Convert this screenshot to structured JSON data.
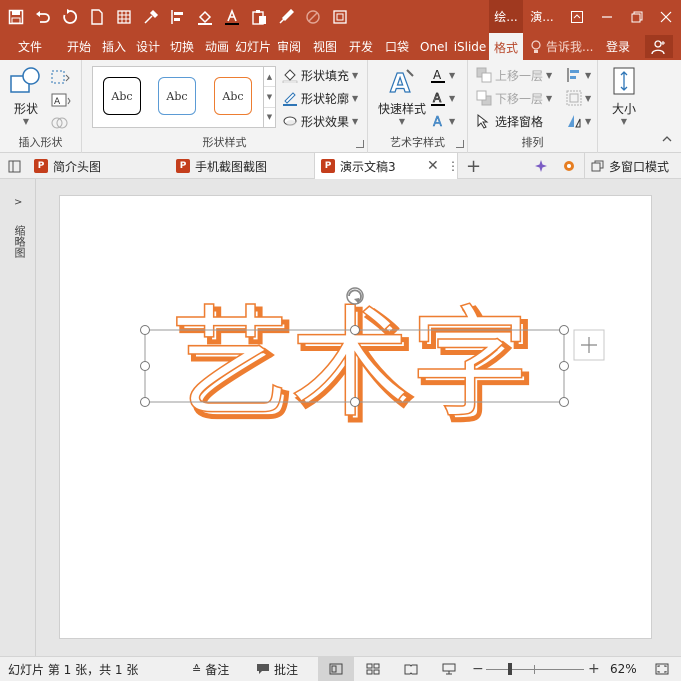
{
  "window": {
    "context_tab": "绘...",
    "title": "演...",
    "accent": "#b7472a"
  },
  "qat": [
    "save-icon",
    "undo-icon",
    "redo-icon",
    "new-icon",
    "grid-icon",
    "eyedropper-icon",
    "align-icon",
    "fill-icon",
    "font-color-icon",
    "paste-icon",
    "brush-icon",
    "disabled-icon",
    "crop-icon"
  ],
  "tabs": [
    "文件",
    "开始",
    "插入",
    "设计",
    "切换",
    "动画",
    "幻灯片",
    "审阅",
    "视图",
    "开发",
    "口袋",
    "OneI",
    "iSlide",
    "格式"
  ],
  "tellme": "告诉我...",
  "login": "登录",
  "ribbon": {
    "insert_shape": {
      "shape_label": "形状",
      "group_label": "插入形状"
    },
    "shape_styles": {
      "swatches": [
        "Abc",
        "Abc",
        "Abc"
      ],
      "swatch_colors": [
        "#000000",
        "#5b9bd5",
        "#ed7d31"
      ],
      "fill": "形状填充",
      "outline": "形状轮廓",
      "effects": "形状效果",
      "group_label": "形状样式"
    },
    "wordart": {
      "quick_styles": "快速样式",
      "group_label": "艺术字样式"
    },
    "arrange": {
      "bring_forward": "上移一层",
      "send_backward": "下移一层",
      "selection_pane": "选择窗格",
      "group_label": "排列"
    },
    "size": {
      "label": "大小"
    }
  },
  "doctabs": [
    {
      "name": "简介头图"
    },
    {
      "name": "手机截图截图"
    },
    {
      "name": "演示文稿3"
    }
  ],
  "doctabs_right": {
    "multi_window": "多窗口模式"
  },
  "slide": {
    "wordart_text": "艺术字",
    "outline_color": "#ed7d31"
  },
  "left_panel_label": "缩略图",
  "status": {
    "slide_info": "幻灯片 第 1 张，共 1 张",
    "notes": "备注",
    "comments": "批注",
    "zoom": "62%"
  }
}
